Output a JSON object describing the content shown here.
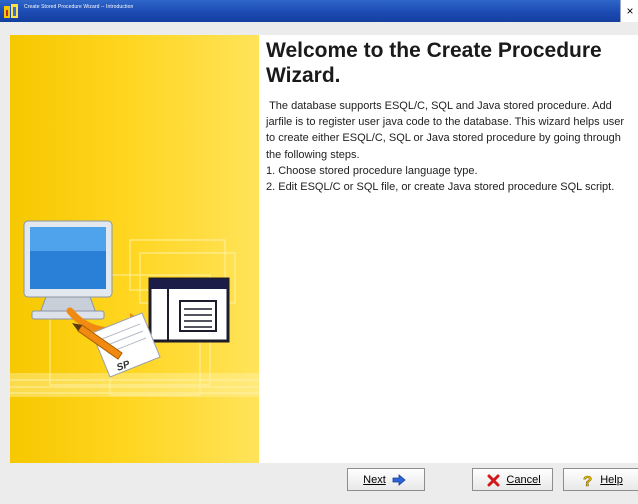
{
  "window": {
    "title": "Create Stored Procedure Wizard -- Introduction",
    "close_glyph": "×"
  },
  "welcome": {
    "title": "Welcome to the Create Procedure Wizard.",
    "paragraphs": [
      " The database supports ESQL/C, SQL and Java stored procedure. Add jarfile is to register user java code to the database. This wizard helps user to create either ESQL/C, SQL or Java stored procedure by going through the following steps.",
      "1. Choose stored procedure language type.",
      "2. Edit ESQL/C or SQL file, or create Java stored procedure SQL script."
    ]
  },
  "illustration": {
    "document_label": "SP"
  },
  "buttons": {
    "next": "Next",
    "cancel": "Cancel",
    "help": "Help"
  },
  "colors": {
    "title_bar": "#1c4bb3",
    "left_panel": "#ffd51e",
    "next_arrow": "#2d63d8",
    "cancel_x": "#d01a1a",
    "help_icon": "#f0c800"
  },
  "icons": {
    "next": "right-arrow-icon",
    "cancel": "red-x-icon",
    "help": "question-mark-icon",
    "app": "database-wizard-icon"
  }
}
